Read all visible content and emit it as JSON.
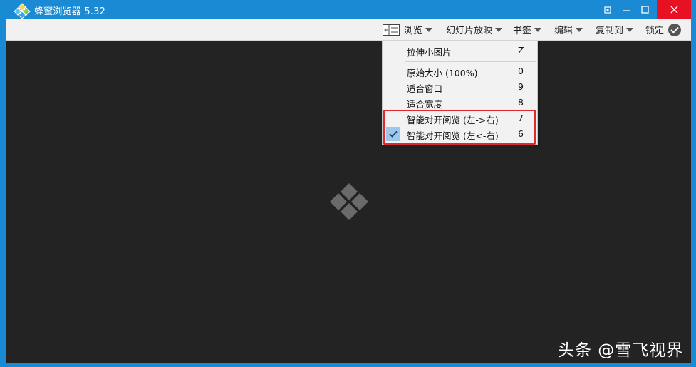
{
  "window": {
    "title": "蜂蜜浏览器 5.32",
    "accent_color": "#1a8ad4",
    "close_color": "#e81123",
    "icons": [
      "restore-small-icon",
      "minimize-icon",
      "maximize-icon",
      "close-icon"
    ]
  },
  "toolbar": {
    "items": [
      {
        "label": "浏览",
        "icon": "browse-panel-icon"
      },
      {
        "label": "幻灯片放映"
      },
      {
        "label": "书签"
      },
      {
        "label": "编辑"
      },
      {
        "label": "复制到"
      },
      {
        "label": "锁定",
        "icon": "check-circle-icon"
      }
    ]
  },
  "menu": {
    "items": [
      {
        "label": "拉伸小图片",
        "key": "Z"
      },
      {
        "label": "原始大小 (100%)",
        "key": "0"
      },
      {
        "label": "适合窗口",
        "key": "9"
      },
      {
        "label": "适合宽度",
        "key": "8"
      },
      {
        "label": "智能对开阅览 (左->右)",
        "key": "7"
      },
      {
        "label": "智能对开阅览 (左<-右)",
        "key": "6",
        "checked": true
      }
    ]
  },
  "viewer": {
    "background": "#232323",
    "watermark": "头条 @雪飞视界"
  }
}
